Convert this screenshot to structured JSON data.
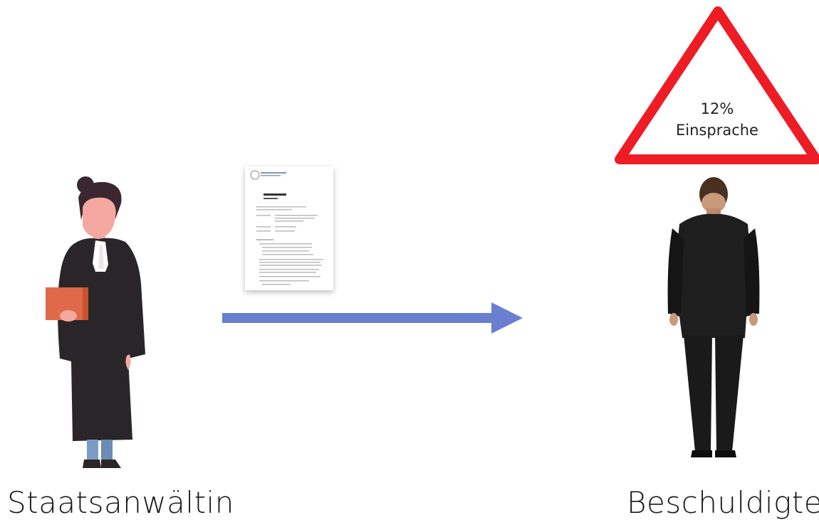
{
  "warning": {
    "percent": "12%",
    "label": "Einsprache",
    "color": "#ee1c24"
  },
  "left_person": {
    "label": "Staatsanwältin",
    "icon": "prosecutor-icon"
  },
  "right_person": {
    "label": "Beschuldigter",
    "icon": "accused-man-icon"
  },
  "document": {
    "icon": "penalty-order-document-icon",
    "title": "Strafbefehl"
  },
  "arrow": {
    "color": "#6a7fcf",
    "icon": "arrow-right-icon"
  }
}
